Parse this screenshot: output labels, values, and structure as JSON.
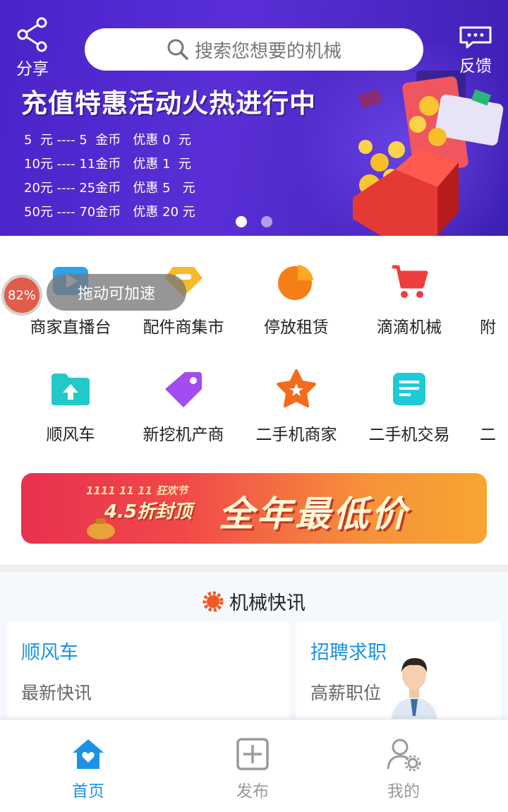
{
  "header": {
    "share_label": "分享",
    "feedback_label": "反馈",
    "search_placeholder": "搜索您想要的机械"
  },
  "banner": {
    "title": "充值特惠活动火热进行中",
    "rates": [
      "5  元 ---- 5  金币   优惠 0  元",
      "10元 ---- 11金币   优惠 1  元",
      "20元 ---- 25金币   优惠 5   元",
      "50元 ---- 70金币   优惠 20 元"
    ],
    "page_count": 2,
    "active_page": 1
  },
  "categories": {
    "row1": [
      {
        "label": "商家直播台",
        "icon": "live-video-icon",
        "color": "#2aa3f0"
      },
      {
        "label": "配件商集市",
        "icon": "tag-diamond-icon",
        "color": "#f7b928"
      },
      {
        "label": "停放租赁",
        "icon": "pie-chart-icon",
        "color": "#f57f17"
      },
      {
        "label": "滴滴机械",
        "icon": "shopping-cart-icon",
        "color": "#ef3e3e"
      },
      {
        "label": "附",
        "icon": "more-icon",
        "color": "#1a93e6"
      }
    ],
    "row2": [
      {
        "label": "顺风车",
        "icon": "folder-upload-icon",
        "color": "#23c9c6"
      },
      {
        "label": "新挖机产商",
        "icon": "price-tag-icon",
        "color": "#a34cf0"
      },
      {
        "label": "二手机商家",
        "icon": "star-badge-icon",
        "color": "#f36b1c"
      },
      {
        "label": "二手机交易",
        "icon": "document-icon",
        "color": "#1fc9d6"
      },
      {
        "label": "二",
        "icon": "more-icon",
        "color": "#1a93e6"
      }
    ]
  },
  "floating": {
    "percent": "82%",
    "hint": "拖动可加速"
  },
  "ad": {
    "small_text": "1111 11 11 狂欢节",
    "prefix": "4.5折封顶",
    "headline": "全年最低价"
  },
  "news": {
    "section_title": "机械快讯",
    "cards": [
      {
        "title": "顺风车",
        "subtitle": "最新快讯"
      },
      {
        "title": "招聘求职",
        "subtitle": "高薪职位"
      }
    ]
  },
  "bottom_nav": [
    {
      "label": "首页",
      "active": true
    },
    {
      "label": "发布",
      "active": false
    },
    {
      "label": "我的",
      "active": false
    }
  ],
  "colors": {
    "accent": "#1a93e6",
    "banner_bg": "#4a23c9",
    "inactive_nav": "#9a9a9a"
  }
}
